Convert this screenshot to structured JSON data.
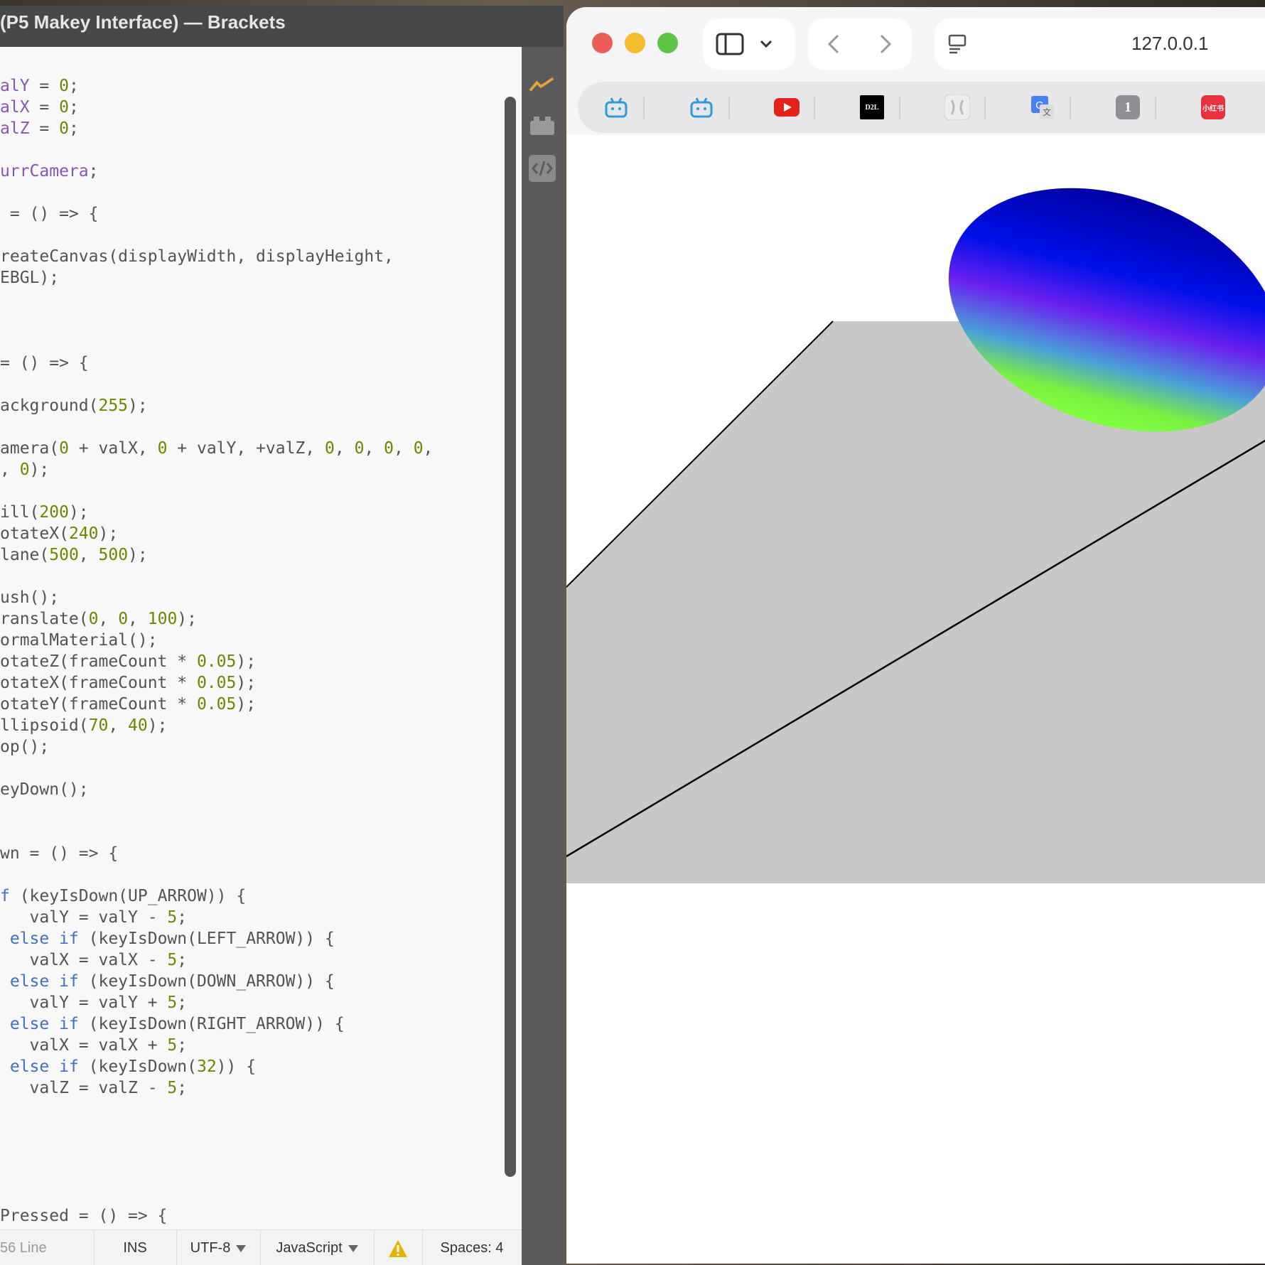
{
  "brackets": {
    "title": "(P5 Makey Interface) — Brackets",
    "code_lines": [
      [
        {
          "t": "alY",
          "c": "v"
        },
        {
          "t": " = "
        },
        {
          "t": "0",
          "c": "n"
        },
        {
          "t": ";"
        }
      ],
      [
        {
          "t": "alX",
          "c": "v"
        },
        {
          "t": " = "
        },
        {
          "t": "0",
          "c": "n"
        },
        {
          "t": ";"
        }
      ],
      [
        {
          "t": "alZ",
          "c": "v"
        },
        {
          "t": " = "
        },
        {
          "t": "0",
          "c": "n"
        },
        {
          "t": ";"
        }
      ],
      [],
      [
        {
          "t": "urrCamera",
          "c": "v"
        },
        {
          "t": ";"
        }
      ],
      [],
      [
        {
          "t": " = () => {"
        }
      ],
      [],
      [
        {
          "t": "reateCanvas(displayWidth, displayHeight,"
        }
      ],
      [
        {
          "t": "EBGL);"
        }
      ],
      [],
      [],
      [],
      [
        {
          "t": "= () => {"
        }
      ],
      [],
      [
        {
          "t": "ackground("
        },
        {
          "t": "255",
          "c": "n"
        },
        {
          "t": ");"
        }
      ],
      [],
      [
        {
          "t": "amera("
        },
        {
          "t": "0",
          "c": "n"
        },
        {
          "t": " + valX, "
        },
        {
          "t": "0",
          "c": "n"
        },
        {
          "t": " + valY, +valZ, "
        },
        {
          "t": "0",
          "c": "n"
        },
        {
          "t": ", "
        },
        {
          "t": "0",
          "c": "n"
        },
        {
          "t": ", "
        },
        {
          "t": "0",
          "c": "n"
        },
        {
          "t": ", "
        },
        {
          "t": "0",
          "c": "n"
        },
        {
          "t": ","
        }
      ],
      [
        {
          "t": ", "
        },
        {
          "t": "0",
          "c": "n"
        },
        {
          "t": ");"
        }
      ],
      [],
      [
        {
          "t": "ill("
        },
        {
          "t": "200",
          "c": "n"
        },
        {
          "t": ");"
        }
      ],
      [
        {
          "t": "otateX("
        },
        {
          "t": "240",
          "c": "n"
        },
        {
          "t": ");"
        }
      ],
      [
        {
          "t": "lane("
        },
        {
          "t": "500",
          "c": "n"
        },
        {
          "t": ", "
        },
        {
          "t": "500",
          "c": "n"
        },
        {
          "t": ");"
        }
      ],
      [],
      [
        {
          "t": "ush();"
        }
      ],
      [
        {
          "t": "ranslate("
        },
        {
          "t": "0",
          "c": "n"
        },
        {
          "t": ", "
        },
        {
          "t": "0",
          "c": "n"
        },
        {
          "t": ", "
        },
        {
          "t": "100",
          "c": "n"
        },
        {
          "t": ");"
        }
      ],
      [
        {
          "t": "ormalMaterial();"
        }
      ],
      [
        {
          "t": "otateZ(frameCount * "
        },
        {
          "t": "0.05",
          "c": "n"
        },
        {
          "t": ");"
        }
      ],
      [
        {
          "t": "otateX(frameCount * "
        },
        {
          "t": "0.05",
          "c": "n"
        },
        {
          "t": ");"
        }
      ],
      [
        {
          "t": "otateY(frameCount * "
        },
        {
          "t": "0.05",
          "c": "n"
        },
        {
          "t": ");"
        }
      ],
      [
        {
          "t": "llipsoid("
        },
        {
          "t": "70",
          "c": "n"
        },
        {
          "t": ", "
        },
        {
          "t": "40",
          "c": "n"
        },
        {
          "t": ");"
        }
      ],
      [
        {
          "t": "op();"
        }
      ],
      [],
      [
        {
          "t": "eyDown();"
        }
      ],
      [],
      [],
      [
        {
          "t": "wn = () => {"
        }
      ],
      [],
      [
        {
          "t": "f",
          "c": "k"
        },
        {
          "t": " (keyIsDown(UP_ARROW)) {"
        }
      ],
      [
        {
          "t": "   valY = valY - "
        },
        {
          "t": "5",
          "c": "n"
        },
        {
          "t": ";"
        }
      ],
      [
        {
          "t": " "
        },
        {
          "t": "else if",
          "c": "k"
        },
        {
          "t": " (keyIsDown(LEFT_ARROW)) {"
        }
      ],
      [
        {
          "t": "   valX = valX - "
        },
        {
          "t": "5",
          "c": "n"
        },
        {
          "t": ";"
        }
      ],
      [
        {
          "t": " "
        },
        {
          "t": "else if",
          "c": "k"
        },
        {
          "t": " (keyIsDown(DOWN_ARROW)) {"
        }
      ],
      [
        {
          "t": "   valY = valY + "
        },
        {
          "t": "5",
          "c": "n"
        },
        {
          "t": ";"
        }
      ],
      [
        {
          "t": " "
        },
        {
          "t": "else if",
          "c": "k"
        },
        {
          "t": " (keyIsDown(RIGHT_ARROW)) {"
        }
      ],
      [
        {
          "t": "   valX = valX + "
        },
        {
          "t": "5",
          "c": "n"
        },
        {
          "t": ";"
        }
      ],
      [
        {
          "t": " "
        },
        {
          "t": "else if",
          "c": "k"
        },
        {
          "t": " (keyIsDown("
        },
        {
          "t": "32",
          "c": "n"
        },
        {
          "t": ")) {"
        }
      ],
      [
        {
          "t": "   valZ = valZ - "
        },
        {
          "t": "5",
          "c": "n"
        },
        {
          "t": ";"
        }
      ],
      [],
      [],
      [],
      [],
      [],
      [
        {
          "t": "Pressed = () => {"
        }
      ]
    ],
    "status": {
      "lines": "56 Line",
      "mode": "INS",
      "encoding": "UTF-8",
      "language": "JavaScript",
      "spaces_label": "Spaces:",
      "spaces_value": "4"
    },
    "side_icons": [
      "live-preview-icon",
      "extension-icon",
      "code-icon"
    ]
  },
  "safari": {
    "url": "127.0.0.1",
    "favorites": [
      {
        "name": "bilibili-icon",
        "color": "#2f9bd6"
      },
      {
        "name": "bilibili-icon",
        "color": "#2f9bd6"
      },
      {
        "name": "youtube-icon",
        "color": "#e62117"
      },
      {
        "name": "d2l-icon",
        "text": "D2L",
        "color": "#000000"
      },
      {
        "name": "outline-app-icon",
        "color": "#cccccc"
      },
      {
        "name": "google-translate-icon",
        "color": "#4a80f5"
      },
      {
        "name": "tab-count-icon",
        "text": "1",
        "color": "#8e8e93"
      },
      {
        "name": "xiaohongshu-icon",
        "text": "小红书",
        "color": "#e8333f"
      }
    ]
  },
  "colors": {
    "plane": "#c8c8c8",
    "titlebar": "#47484a",
    "editor_bg": "#f8f8f8"
  }
}
